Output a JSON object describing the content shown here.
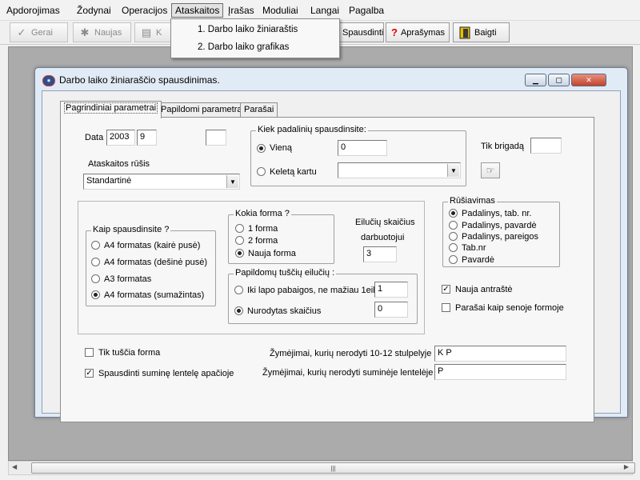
{
  "menu": {
    "items": [
      "Apdorojimas",
      "Žodynai",
      "Operacijos",
      "Ataskaitos",
      "Įrašas",
      "Moduliai",
      "Langai",
      "Pagalba"
    ],
    "open_item": "Ataskaitos",
    "dropdown": [
      "1. Darbo laiko žiniaraštis",
      "2. Darbo laiko grafikas"
    ]
  },
  "toolbar": {
    "gerai": "Gerai",
    "naujas": "Naujas",
    "k_partial": "K",
    "spausdinti": "Spausdinti",
    "aprasymas": "Aprašymas",
    "baigti": "Baigti"
  },
  "dialog": {
    "title": "Darbo laiko žiniaraščio spausdinimas.",
    "tabs": [
      "Pagrindiniai parametrai",
      "Papildomi parametrai",
      "Parašai"
    ],
    "active_tab": 0,
    "data_label": "Data",
    "year": "2003",
    "month": "9",
    "extra_field": "",
    "ataskaitos_rusis_label": "Ataskaitos rūšis",
    "ataskaitos_rusis_value": "Standartinė",
    "kiek_padaliniu": {
      "title": "Kiek padalinių spausdinsite:",
      "viena_label": "Vieną",
      "viena_value": "0",
      "keleta_label": "Keletą kartu",
      "keleta_value": "",
      "selected": "Vieną"
    },
    "tik_brigada_label": "Tik brigadą",
    "tik_brigada_value": "",
    "kaip_spausdinsite": {
      "title": "Kaip spausdinsite ?",
      "options": [
        "A4 formatas (kairė pusė)",
        "A4 formatas (dešinė pusė)",
        "A3 formatas",
        "A4 formatas (sumažintas)"
      ],
      "selected": "A4 formatas (sumažintas)"
    },
    "kokia_forma": {
      "title": "Kokia forma ?",
      "options": [
        "1 forma",
        "2 forma",
        "Nauja forma"
      ],
      "selected": "Nauja forma"
    },
    "eiluciu_skaicius_label_1": "Eilučių skaičius",
    "eiluciu_skaicius_label_2": "darbuotojui",
    "eiluciu_skaicius_value": "3",
    "papildomu_eiluciu": {
      "title": "Papildomų tuščių eilučių :",
      "iki_lapo_label": "Iki lapo pabaigos, ne mažiau 1eil.",
      "iki_lapo_value": "1",
      "nurodytas_label": "Nurodytas skaičius",
      "nurodytas_value": "0",
      "selected": "Nurodytas skaičius"
    },
    "rusiavimas": {
      "title": "Rūšiavimas",
      "options": [
        "Padalinys, tab. nr.",
        "Padalinys, pavardė",
        "Padalinys, pareigos",
        "Tab.nr",
        "Pavardė"
      ],
      "selected": "Padalinys, tab. nr."
    },
    "nauja_antraste": {
      "label": "Nauja antraštė",
      "checked": true
    },
    "parasai_seno": {
      "label": "Parašai kaip senoje formoje",
      "checked": false
    },
    "tik_tuscia_forma": {
      "label": "Tik tuščia forma",
      "checked": false
    },
    "spausdinti_sumine": {
      "label": "Spausdinti suminę lentelę apačioje",
      "checked": true
    },
    "zymejimai_10_12_label": "Žymėjimai, kurių nerodyti 10-12 stulpelyje",
    "zymejimai_10_12_value": "K P",
    "zymejimai_sumine_label": "Žymėjimai, kurių nerodyti suminėje lentelėje",
    "zymejimai_sumine_value": "P"
  },
  "icons": {
    "gerai": "check-icon",
    "naujas": "new-icon",
    "spausdinti": "printer-icon",
    "aprasymas": "question-icon",
    "baigti": "exit-door-icon",
    "brigada": "pointing-hand-icon"
  }
}
